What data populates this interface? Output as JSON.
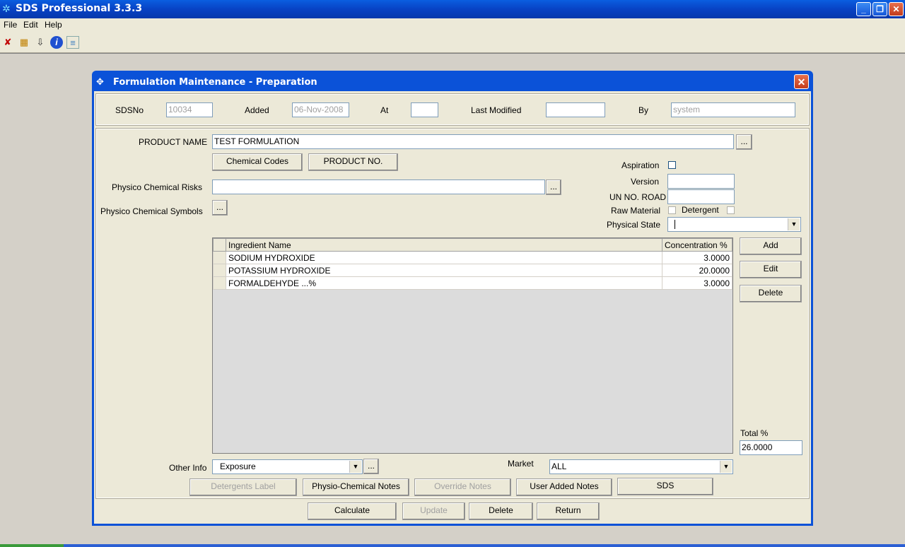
{
  "app": {
    "title": "SDS Professional 3.3.3"
  },
  "menu": [
    "File",
    "Edit",
    "Help"
  ],
  "toolbar_icons": [
    "exit-icon",
    "calendar-icon",
    "import-icon",
    "info-icon",
    "document-icon"
  ],
  "dialog": {
    "title": "Formulation Maintenance - Preparation",
    "header": {
      "sdsno_label": "SDSNo",
      "sdsno_value": "10034",
      "added_label": "Added",
      "added_value": "06-Nov-2008",
      "at_label": "At",
      "at_value": "",
      "last_modified_label": "Last Modified",
      "last_modified_value": "",
      "by_label": "By",
      "by_value": "system"
    },
    "product_name_label": "PRODUCT NAME",
    "product_name_value": "TEST FORMULATION",
    "ellipsis": "...",
    "chemical_codes_button": "Chemical Codes",
    "product_no_button": "PRODUCT NO.",
    "physico_risks_label": "Physico Chemical Risks",
    "physico_risks_value": "",
    "physico_symbols_label": "Physico Chemical Symbols",
    "aspiration_label": "Aspiration",
    "version_label": "Version",
    "version_value": "",
    "un_no_road_label": "UN NO. ROAD",
    "un_no_road_value": "",
    "raw_material_label": "Raw Material",
    "detergent_label": "Detergent",
    "physical_state_label": "Physical State",
    "physical_state_value": "",
    "grid": {
      "columns": [
        "Ingredient Name",
        "Concentration %"
      ],
      "rows": [
        [
          "SODIUM HYDROXIDE",
          "3.0000"
        ],
        [
          "POTASSIUM HYDROXIDE",
          "20.0000"
        ],
        [
          "FORMALDEHYDE ...%",
          "3.0000"
        ]
      ]
    },
    "add_button": "Add",
    "edit_button": "Edit",
    "delete_side_button": "Delete",
    "total_label": "Total %",
    "total_value": "26.0000",
    "other_info_label": "Other Info",
    "other_info_value": "Exposure",
    "market_label": "Market",
    "market_value": "ALL",
    "notes_buttons": {
      "detergents_label": "Detergents Label",
      "physio_chemical_notes": "Physio-Chemical Notes",
      "override_notes": "Override Notes",
      "user_added_notes": "User Added Notes",
      "sds": "SDS"
    },
    "bottom_buttons": {
      "calculate": "Calculate",
      "update": "Update",
      "delete": "Delete",
      "return": "Return"
    }
  }
}
